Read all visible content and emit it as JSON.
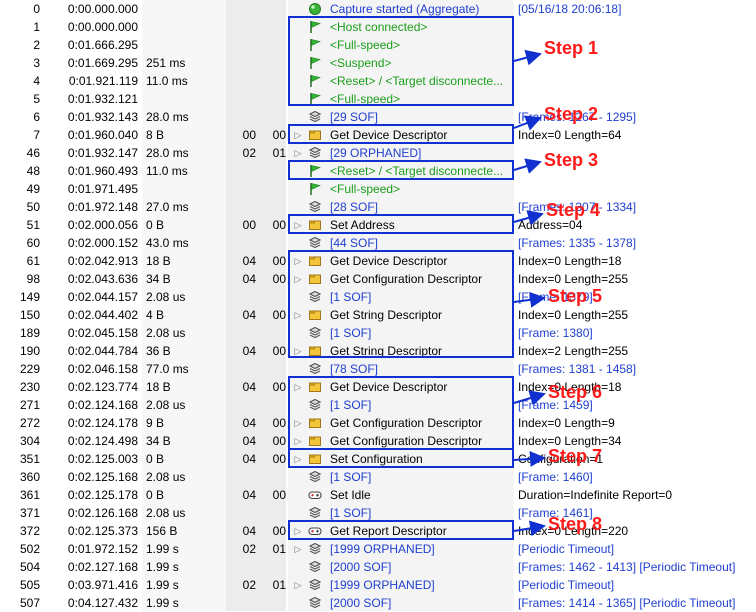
{
  "rows": [
    {
      "idx": "0",
      "time": "0:00.000.000",
      "dur": "",
      "a": "",
      "b": "",
      "exp": false,
      "icon": "circle",
      "desc": "Capture started (Aggregate)",
      "desc_color": "link",
      "info": "[05/16/18 20:06:18]",
      "info_color": "link"
    },
    {
      "idx": "1",
      "time": "0:00.000.000",
      "dur": "",
      "a": "",
      "b": "",
      "exp": false,
      "icon": "flag",
      "desc": "<Host connected>",
      "desc_color": "green",
      "info": "",
      "info_color": "link"
    },
    {
      "idx": "2",
      "time": "0:01.666.295",
      "dur": "",
      "a": "",
      "b": "",
      "exp": false,
      "icon": "flag",
      "desc": "<Full-speed>",
      "desc_color": "green",
      "info": "",
      "info_color": "link"
    },
    {
      "idx": "3",
      "time": "0:01.669.295",
      "dur": "251 ms",
      "a": "",
      "b": "",
      "exp": false,
      "icon": "flag",
      "desc": "<Suspend>",
      "desc_color": "green",
      "info": "",
      "info_color": "link"
    },
    {
      "idx": "4",
      "time": "0:01.921.119",
      "dur": "11.0 ms",
      "a": "",
      "b": "",
      "exp": false,
      "icon": "flag",
      "desc": "<Reset> / <Target disconnecte...",
      "desc_color": "green",
      "info": "",
      "info_color": "link"
    },
    {
      "idx": "5",
      "time": "0:01.932.121",
      "dur": "",
      "a": "",
      "b": "",
      "exp": false,
      "icon": "flag",
      "desc": "<Full-speed>",
      "desc_color": "green",
      "info": "",
      "info_color": "link"
    },
    {
      "idx": "6",
      "time": "0:01.932.143",
      "dur": "28.0 ms",
      "a": "",
      "b": "",
      "exp": false,
      "icon": "stack",
      "desc": "[29 SOF]",
      "desc_color": "link",
      "info": "[Frames: 1267 - 1295]",
      "info_color": "link"
    },
    {
      "idx": "7",
      "time": "0:01.960.040",
      "dur": "8 B",
      "a": "00",
      "b": "00",
      "exp": true,
      "icon": "folder",
      "desc": "Get Device Descriptor",
      "desc_color": "black",
      "info": "Index=0 Length=64",
      "info_color": "black"
    },
    {
      "idx": "46",
      "time": "0:01.932.147",
      "dur": "28.0 ms",
      "a": "02",
      "b": "01",
      "exp": true,
      "icon": "stack",
      "desc": "[29 ORPHANED]",
      "desc_color": "link",
      "info": "",
      "info_color": "link"
    },
    {
      "idx": "48",
      "time": "0:01.960.493",
      "dur": "11.0 ms",
      "a": "",
      "b": "",
      "exp": false,
      "icon": "flag",
      "desc": "<Reset> / <Target disconnecte...",
      "desc_color": "green",
      "info": "",
      "info_color": "link"
    },
    {
      "idx": "49",
      "time": "0:01.971.495",
      "dur": "",
      "a": "",
      "b": "",
      "exp": false,
      "icon": "flag",
      "desc": "<Full-speed>",
      "desc_color": "green",
      "info": "",
      "info_color": "link"
    },
    {
      "idx": "50",
      "time": "0:01.972.148",
      "dur": "27.0 ms",
      "a": "",
      "b": "",
      "exp": false,
      "icon": "stack",
      "desc": "[28 SOF]",
      "desc_color": "link",
      "info": "[Frames: 1307 - 1334]",
      "info_color": "link"
    },
    {
      "idx": "51",
      "time": "0:02.000.056",
      "dur": "0 B",
      "a": "00",
      "b": "00",
      "exp": true,
      "icon": "folder",
      "desc": "Set Address",
      "desc_color": "black",
      "info": "Address=04",
      "info_color": "black"
    },
    {
      "idx": "60",
      "time": "0:02.000.152",
      "dur": "43.0 ms",
      "a": "",
      "b": "",
      "exp": false,
      "icon": "stack",
      "desc": "[44 SOF]",
      "desc_color": "link",
      "info": "[Frames: 1335 - 1378]",
      "info_color": "link"
    },
    {
      "idx": "61",
      "time": "0:02.042.913",
      "dur": "18 B",
      "a": "04",
      "b": "00",
      "exp": true,
      "icon": "folder",
      "desc": "Get Device Descriptor",
      "desc_color": "black",
      "info": "Index=0 Length=18",
      "info_color": "black"
    },
    {
      "idx": "98",
      "time": "0:02.043.636",
      "dur": "34 B",
      "a": "04",
      "b": "00",
      "exp": true,
      "icon": "folder",
      "desc": "Get Configuration Descriptor",
      "desc_color": "black",
      "info": "Index=0 Length=255",
      "info_color": "black"
    },
    {
      "idx": "149",
      "time": "0:02.044.157",
      "dur": "2.08 us",
      "a": "",
      "b": "",
      "exp": false,
      "icon": "stack",
      "desc": "[1 SOF]",
      "desc_color": "link",
      "info": "[Frame: 1379]",
      "info_color": "link"
    },
    {
      "idx": "150",
      "time": "0:02.044.402",
      "dur": "4 B",
      "a": "04",
      "b": "00",
      "exp": true,
      "icon": "folder",
      "desc": "Get String Descriptor",
      "desc_color": "black",
      "info": "Index=0 Length=255",
      "info_color": "black"
    },
    {
      "idx": "189",
      "time": "0:02.045.158",
      "dur": "2.08 us",
      "a": "",
      "b": "",
      "exp": false,
      "icon": "stack",
      "desc": "[1 SOF]",
      "desc_color": "link",
      "info": "[Frame: 1380]",
      "info_color": "link"
    },
    {
      "idx": "190",
      "time": "0:02.044.784",
      "dur": "36 B",
      "a": "04",
      "b": "00",
      "exp": true,
      "icon": "folder",
      "desc": "Get String Descriptor",
      "desc_color": "black",
      "info": "Index=2 Length=255",
      "info_color": "black"
    },
    {
      "idx": "229",
      "time": "0:02.046.158",
      "dur": "77.0 ms",
      "a": "",
      "b": "",
      "exp": false,
      "icon": "stack",
      "desc": "[78 SOF]",
      "desc_color": "link",
      "info": "[Frames: 1381 - 1458]",
      "info_color": "link"
    },
    {
      "idx": "230",
      "time": "0:02.123.774",
      "dur": "18 B",
      "a": "04",
      "b": "00",
      "exp": true,
      "icon": "folder",
      "desc": "Get Device Descriptor",
      "desc_color": "black",
      "info": "Index=0 Length=18",
      "info_color": "black"
    },
    {
      "idx": "271",
      "time": "0:02.124.168",
      "dur": "2.08 us",
      "a": "",
      "b": "",
      "exp": false,
      "icon": "stack",
      "desc": "[1 SOF]",
      "desc_color": "link",
      "info": "[Frame: 1459]",
      "info_color": "link"
    },
    {
      "idx": "272",
      "time": "0:02.124.178",
      "dur": "9 B",
      "a": "04",
      "b": "00",
      "exp": true,
      "icon": "folder",
      "desc": "Get Configuration Descriptor",
      "desc_color": "black",
      "info": "Index=0 Length=9",
      "info_color": "black"
    },
    {
      "idx": "304",
      "time": "0:02.124.498",
      "dur": "34 B",
      "a": "04",
      "b": "00",
      "exp": true,
      "icon": "folder",
      "desc": "Get Configuration Descriptor",
      "desc_color": "black",
      "info": "Index=0 Length=34",
      "info_color": "black"
    },
    {
      "idx": "351",
      "time": "0:02.125.003",
      "dur": "0 B",
      "a": "04",
      "b": "00",
      "exp": true,
      "icon": "folder",
      "desc": "Set Configuration",
      "desc_color": "black",
      "info": "Configuration=1",
      "info_color": "black"
    },
    {
      "idx": "360",
      "time": "0:02.125.168",
      "dur": "2.08 us",
      "a": "",
      "b": "",
      "exp": false,
      "icon": "stack",
      "desc": "[1 SOF]",
      "desc_color": "link",
      "info": "[Frame: 1460]",
      "info_color": "link"
    },
    {
      "idx": "361",
      "time": "0:02.125.178",
      "dur": "0 B",
      "a": "04",
      "b": "00",
      "exp": false,
      "icon": "hid",
      "desc": "Set Idle",
      "desc_color": "black",
      "info": "Duration=Indefinite Report=0",
      "info_color": "black"
    },
    {
      "idx": "371",
      "time": "0:02.126.168",
      "dur": "2.08 us",
      "a": "",
      "b": "",
      "exp": false,
      "icon": "stack",
      "desc": "[1 SOF]",
      "desc_color": "link",
      "info": "[Frame: 1461]",
      "info_color": "link"
    },
    {
      "idx": "372",
      "time": "0:02.125.373",
      "dur": "156 B",
      "a": "04",
      "b": "00",
      "exp": true,
      "icon": "hid",
      "desc": "Get Report Descriptor",
      "desc_color": "black",
      "info": "Index=0 Length=220",
      "info_color": "black"
    },
    {
      "idx": "502",
      "time": "0:01.972.152",
      "dur": "1.99 s",
      "a": "02",
      "b": "01",
      "exp": true,
      "icon": "stack",
      "desc": "[1999 ORPHANED]",
      "desc_color": "link",
      "info": "[Periodic Timeout]",
      "info_color": "link"
    },
    {
      "idx": "504",
      "time": "0:02.127.168",
      "dur": "1.99 s",
      "a": "",
      "b": "",
      "exp": false,
      "icon": "stack",
      "desc": "[2000 SOF]",
      "desc_color": "link",
      "info": "[Frames: 1462 - 1413] [Periodic Timeout]",
      "info_color": "link"
    },
    {
      "idx": "505",
      "time": "0:03.971.416",
      "dur": "1.99 s",
      "a": "02",
      "b": "01",
      "exp": true,
      "icon": "stack",
      "desc": "[1999 ORPHANED]",
      "desc_color": "link",
      "info": "[Periodic Timeout]",
      "info_color": "link"
    },
    {
      "idx": "507",
      "time": "0:04.127.432",
      "dur": "1.99 s",
      "a": "",
      "b": "",
      "exp": false,
      "icon": "stack",
      "desc": "[2000 SOF]",
      "desc_color": "link",
      "info": "[Frames: 1414 - 1365] [Periodic Timeout]",
      "info_color": "link"
    }
  ],
  "steps": [
    {
      "label": "Step 1"
    },
    {
      "label": "Step 2"
    },
    {
      "label": "Step 3"
    },
    {
      "label": "Step 4"
    },
    {
      "label": "Step 5"
    },
    {
      "label": "Step 6"
    },
    {
      "label": "Step 7"
    },
    {
      "label": "Step 8"
    }
  ],
  "colors": {
    "link": "#1f3fd0",
    "green": "#1a9e1a",
    "highlight": "#1030d0",
    "step": "#ff1a1a"
  },
  "icons": {
    "circle": "green-circle-icon",
    "flag": "green-flag-icon",
    "stack": "frames-stack-icon",
    "folder": "transfer-folder-icon",
    "hid": "hid-device-icon"
  }
}
